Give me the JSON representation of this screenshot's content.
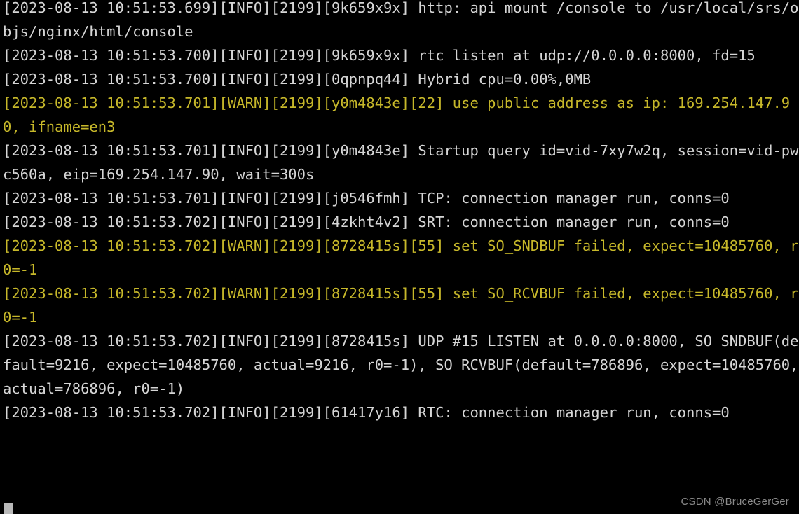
{
  "terminal": {
    "title": "srs server console log",
    "background_color": "#000000",
    "info_color": "#d6d6d6",
    "warn_color": "#c7b82a",
    "cursor_color": "#b9b9b9",
    "cursor_glyph": "block-cursor",
    "font_size_px": 20.5,
    "wrap_columns": 82,
    "lines": [
      {
        "level": "INFO",
        "text": "[2023-08-13 10:51:53.699][INFO][2199][9k659x9x] http: api mount /console to /usr/local/srs/objs/nginx/html/console",
        "clipped_top": true
      },
      {
        "level": "INFO",
        "text": "[2023-08-13 10:51:53.700][INFO][2199][9k659x9x] rtc listen at udp://0.0.0.0:8000, fd=15"
      },
      {
        "level": "INFO",
        "text": "[2023-08-13 10:51:53.700][INFO][2199][0qpnpq44] Hybrid cpu=0.00%,0MB"
      },
      {
        "level": "WARN",
        "text": "[2023-08-13 10:51:53.701][WARN][2199][y0m4843e][22] use public address as ip: 169.254.147.90, ifname=en3"
      },
      {
        "level": "INFO",
        "text": "[2023-08-13 10:51:53.701][INFO][2199][y0m4843e] Startup query id=vid-7xy7w2q, session=vid-pwc560a, eip=169.254.147.90, wait=300s"
      },
      {
        "level": "INFO",
        "text": "[2023-08-13 10:51:53.701][INFO][2199][j0546fmh] TCP: connection manager run, conns=0"
      },
      {
        "level": "INFO",
        "text": "[2023-08-13 10:51:53.702][INFO][2199][4zkht4v2] SRT: connection manager run, conns=0"
      },
      {
        "level": "WARN",
        "text": "[2023-08-13 10:51:53.702][WARN][2199][8728415s][55] set SO_SNDBUF failed, expect=10485760, r0=-1"
      },
      {
        "level": "WARN",
        "text": "[2023-08-13 10:51:53.702][WARN][2199][8728415s][55] set SO_RCVBUF failed, expect=10485760, r0=-1"
      },
      {
        "level": "INFO",
        "text": "[2023-08-13 10:51:53.702][INFO][2199][8728415s] UDP #15 LISTEN at 0.0.0.0:8000, SO_SNDBUF(default=9216, expect=10485760, actual=9216, r0=-1), SO_RCVBUF(default=786896, expect=10485760, actual=786896, r0=-1)"
      },
      {
        "level": "INFO",
        "text": "[2023-08-13 10:51:53.702][INFO][2199][61417y16] RTC: connection manager run, conns=0"
      }
    ]
  },
  "watermark": {
    "text": "CSDN @BruceGerGer"
  }
}
